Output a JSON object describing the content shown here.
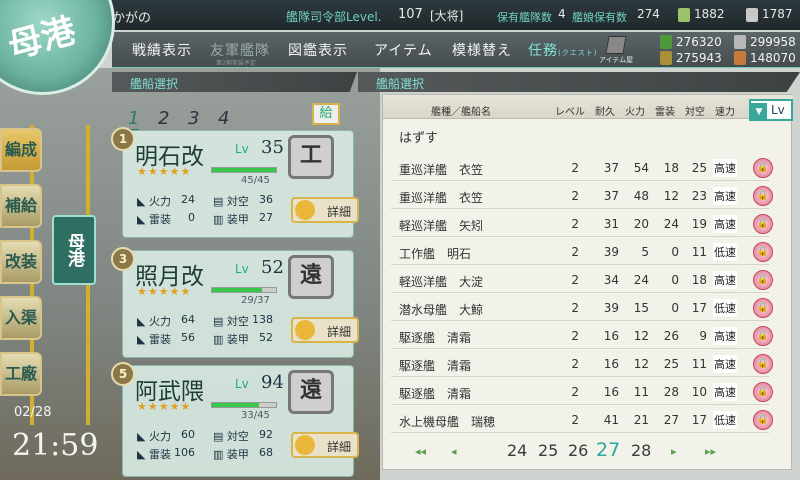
{
  "header": {
    "admiral_name": "かがの",
    "hq_level_label": "艦隊司令部Level.",
    "hq_level": "107",
    "rank": "[大将]",
    "ship_count_label": "保有艦隊数",
    "ship_count": "4",
    "equip_count_label": "艦娘保有数",
    "equip_count": "274",
    "bucket": "1882",
    "devmat": "1787"
  },
  "menu": {
    "record": "戦績表示",
    "ally": "友軍艦隊",
    "ally_sub": "第2期実装予定",
    "library": "図鑑表示",
    "item": "アイテム",
    "furniture": "模様替え",
    "quest": "任務",
    "quest_sub": "(クエスト)",
    "item_shop": "アイテム屋"
  },
  "resources": {
    "fuel": "276320",
    "steel": "299958",
    "ammo": "275943",
    "bauxite": "148070"
  },
  "sections": {
    "left": "艦船選択",
    "right": "艦船選択"
  },
  "logo_text": "母港",
  "side_menu": [
    {
      "label": "編成"
    },
    {
      "label": "補給"
    },
    {
      "label": "改装"
    },
    {
      "label": "入渠"
    },
    {
      "label": "工廠"
    }
  ],
  "swap_button": "母港",
  "date": "02/28",
  "clock": "21:59",
  "fleet_tabs": [
    "1",
    "2",
    "3",
    "4"
  ],
  "supply_button": "給",
  "ships": [
    {
      "num": "1",
      "name": "明石改",
      "lv_label": "Lv",
      "lv": "35",
      "stars": "★★★★★",
      "hp_text": "45/45",
      "hp_ratio": 1.0,
      "firepower_label": "火力",
      "firepower": "24",
      "aa_label": "対空",
      "aa": "36",
      "torpedo_label": "雷装",
      "torpedo": "0",
      "armor_label": "装甲",
      "armor": "27",
      "badge": "工",
      "detail": "詳細"
    },
    {
      "num": "3",
      "name": "照月改",
      "lv_label": "Lv",
      "lv": "52",
      "stars": "★★★★★",
      "hp_text": "29/37",
      "hp_ratio": 0.78,
      "firepower_label": "火力",
      "firepower": "64",
      "aa_label": "対空",
      "aa": "138",
      "torpedo_label": "雷装",
      "torpedo": "56",
      "armor_label": "装甲",
      "armor": "52",
      "badge": "遠",
      "detail": "詳細"
    },
    {
      "num": "5",
      "name": "阿武隈",
      "lv_label": "Lv",
      "lv": "94",
      "stars": "★★★★★",
      "hp_text": "33/45",
      "hp_ratio": 0.73,
      "firepower_label": "火力",
      "firepower": "60",
      "aa_label": "対空",
      "aa": "92",
      "torpedo_label": "雷装",
      "torpedo": "106",
      "armor_label": "装甲",
      "armor": "68",
      "badge": "遠",
      "detail": "詳細"
    }
  ],
  "panel": {
    "headers": {
      "name": "艦種／艦船名",
      "level": "レベル",
      "hp": "耐久",
      "fire": "火力",
      "torp": "雷装",
      "aa": "対空",
      "speed": "速力"
    },
    "sort": "Lv",
    "unequip": "はずす",
    "rows": [
      {
        "name": "重巡洋艦　衣笠",
        "lv": "2",
        "hp": "37",
        "fire": "54",
        "torp": "18",
        "aa": "25",
        "speed": "高速"
      },
      {
        "name": "重巡洋艦　衣笠",
        "lv": "2",
        "hp": "37",
        "fire": "48",
        "torp": "12",
        "aa": "23",
        "speed": "高速"
      },
      {
        "name": "軽巡洋艦　矢矧",
        "lv": "2",
        "hp": "31",
        "fire": "20",
        "torp": "24",
        "aa": "19",
        "speed": "高速"
      },
      {
        "name": "工作艦　明石",
        "lv": "2",
        "hp": "39",
        "fire": "5",
        "torp": "0",
        "aa": "11",
        "speed": "低速"
      },
      {
        "name": "軽巡洋艦　大淀",
        "lv": "2",
        "hp": "34",
        "fire": "24",
        "torp": "0",
        "aa": "18",
        "speed": "高速"
      },
      {
        "name": "潜水母艦　大鯨",
        "lv": "2",
        "hp": "39",
        "fire": "15",
        "torp": "0",
        "aa": "17",
        "speed": "低速"
      },
      {
        "name": "駆逐艦　清霜",
        "lv": "2",
        "hp": "16",
        "fire": "12",
        "torp": "26",
        "aa": "9",
        "speed": "高速"
      },
      {
        "name": "駆逐艦　清霜",
        "lv": "2",
        "hp": "16",
        "fire": "12",
        "torp": "25",
        "aa": "11",
        "speed": "高速"
      },
      {
        "name": "駆逐艦　清霜",
        "lv": "2",
        "hp": "16",
        "fire": "11",
        "torp": "28",
        "aa": "10",
        "speed": "高速"
      },
      {
        "name": "水上機母艦　瑞穂",
        "lv": "2",
        "hp": "41",
        "fire": "21",
        "torp": "27",
        "aa": "17",
        "speed": "低速"
      }
    ],
    "pages": [
      "24",
      "25",
      "26",
      "27",
      "28"
    ],
    "current_page": "27"
  }
}
